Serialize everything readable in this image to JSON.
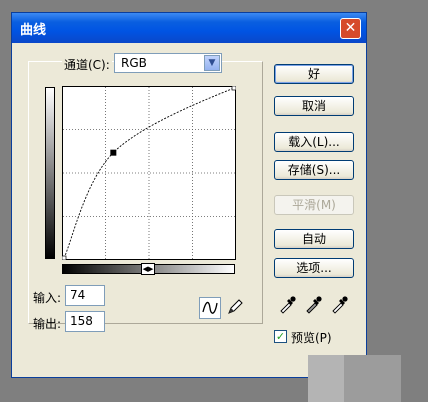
{
  "dialog": {
    "title": "曲线",
    "close_symbol": "✕"
  },
  "channel": {
    "label": "通道(C):",
    "value": "RGB"
  },
  "curve": {
    "input_value": 74,
    "output_value": 158,
    "points": [
      [
        0,
        0
      ],
      [
        74,
        158
      ],
      [
        255,
        255
      ]
    ]
  },
  "inputs": {
    "input_label": "输入:",
    "input_value": "74",
    "output_label": "输出:",
    "output_value": "158"
  },
  "buttons": {
    "ok": "好",
    "cancel": "取消",
    "load": "载入(L)...",
    "save": "存储(S)...",
    "smooth": "平滑(M)",
    "auto": "自动",
    "options": "选项..."
  },
  "preview": {
    "label": "预览(P)",
    "checked": true
  },
  "icons": {
    "curve_tool": "curve-tool-icon",
    "pencil_tool": "pencil-icon",
    "black_eyedropper": "eyedropper-black-icon",
    "gray_eyedropper": "eyedropper-gray-icon",
    "white_eyedropper": "eyedropper-white-icon"
  }
}
